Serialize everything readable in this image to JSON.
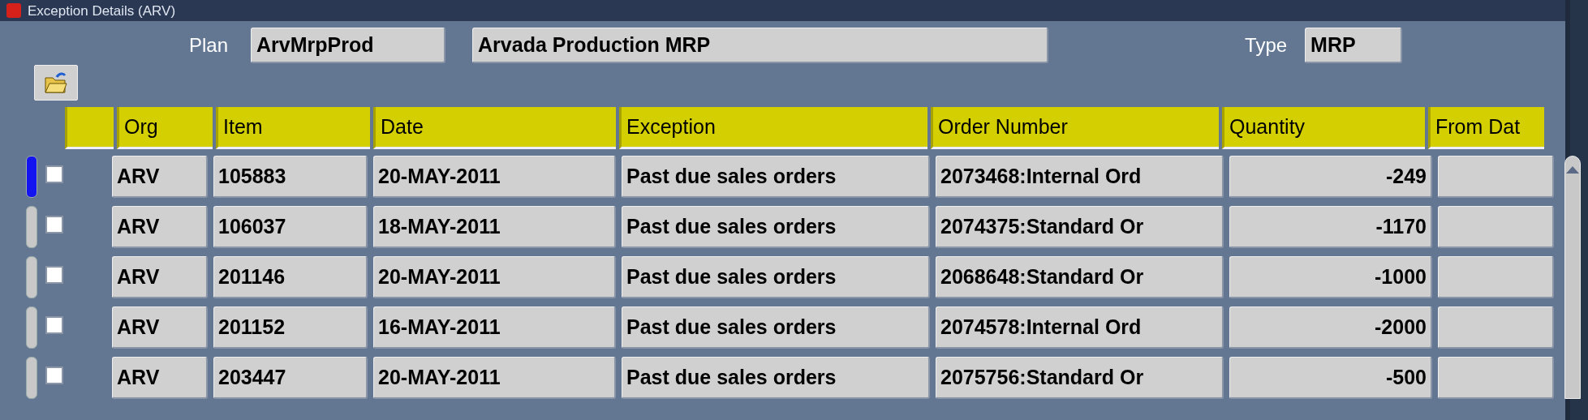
{
  "window": {
    "title": "Exception Details (ARV)"
  },
  "header": {
    "plan_label": "Plan",
    "plan": "ArvMrpProd",
    "plan_description": "Arvada Production MRP",
    "type_label": "Type",
    "type": "MRP"
  },
  "table": {
    "columns": [
      "Org",
      "Item",
      "Date",
      "Exception",
      "Order Number",
      "Quantity",
      "From Dat"
    ],
    "rows": [
      {
        "selected": true,
        "checked": false,
        "cells": [
          "ARV",
          "105883",
          "20-MAY-2011",
          "Past due sales orders",
          "2073468:Internal Ord",
          "-249"
        ]
      },
      {
        "selected": false,
        "checked": false,
        "cells": [
          "ARV",
          "106037",
          "18-MAY-2011",
          "Past due sales orders",
          "2074375:Standard Or",
          "-1170"
        ]
      },
      {
        "selected": false,
        "checked": false,
        "cells": [
          "ARV",
          "201146",
          "20-MAY-2011",
          "Past due sales orders",
          "2068648:Standard Or",
          "-1000"
        ]
      },
      {
        "selected": false,
        "checked": false,
        "cells": [
          "ARV",
          "201152",
          "16-MAY-2011",
          "Past due sales orders",
          "2074578:Internal Ord",
          "-2000"
        ]
      },
      {
        "selected": false,
        "checked": false,
        "cells": [
          "ARV",
          "203447",
          "20-MAY-2011",
          "Past due sales orders",
          "2075756:Standard Or",
          "-500"
        ]
      }
    ]
  }
}
